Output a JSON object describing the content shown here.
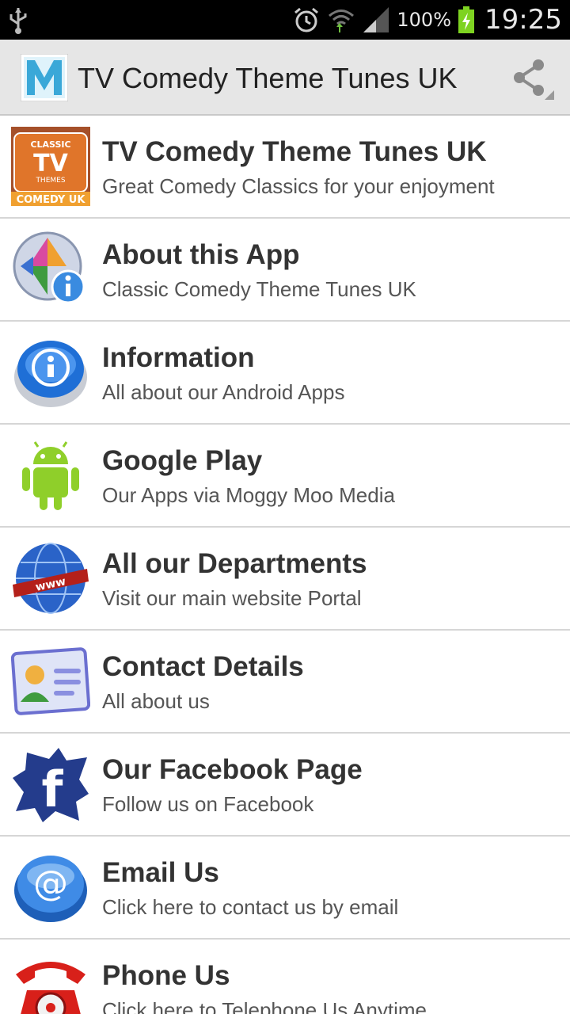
{
  "status_bar": {
    "battery_text": "100%",
    "time": "19:25",
    "icons": [
      "usb-icon",
      "alarm-icon",
      "wifi-icon",
      "signal-icon",
      "battery-icon"
    ]
  },
  "action_bar": {
    "logo_letter": "M",
    "title": "TV Comedy Theme Tunes UK",
    "share_icon": "share-icon"
  },
  "menu": [
    {
      "title": "TV Comedy Theme Tunes UK",
      "subtitle": "Great Comedy Classics for your enjoyment",
      "icon": "tv-comedy-logo-icon",
      "logo_lines": [
        "CLASSIC",
        "TV",
        "THEMES",
        "COMEDY UK"
      ]
    },
    {
      "title": "About this App",
      "subtitle": "Classic Comedy Theme Tunes UK",
      "icon": "about-info-icon"
    },
    {
      "title": "Information",
      "subtitle": "All about our Android Apps",
      "icon": "information-button-icon"
    },
    {
      "title": "Google Play",
      "subtitle": "Our Apps via Moggy Moo Media",
      "icon": "android-robot-icon"
    },
    {
      "title": "All our Departments",
      "subtitle": "Visit our main website Portal",
      "icon": "www-globe-icon",
      "icon_label": "www"
    },
    {
      "title": "Contact Details",
      "subtitle": "All about us",
      "icon": "contact-card-icon"
    },
    {
      "title": "Our Facebook Page",
      "subtitle": "Follow us on Facebook",
      "icon": "facebook-icon",
      "icon_label": "f"
    },
    {
      "title": "Email Us",
      "subtitle": "Click here to contact us by email",
      "icon": "email-at-icon",
      "icon_label": "@"
    },
    {
      "title": "Phone Us",
      "subtitle": "Click here to Telephone Us Anytime",
      "icon": "red-telephone-icon"
    }
  ],
  "colors": {
    "status_bar_bg": "#000000",
    "action_bar_bg": "#e6e6e6",
    "title_text": "#333333",
    "subtitle_text": "#555555",
    "divider": "#d6d6d6",
    "battery_charge": "#7ed321"
  }
}
